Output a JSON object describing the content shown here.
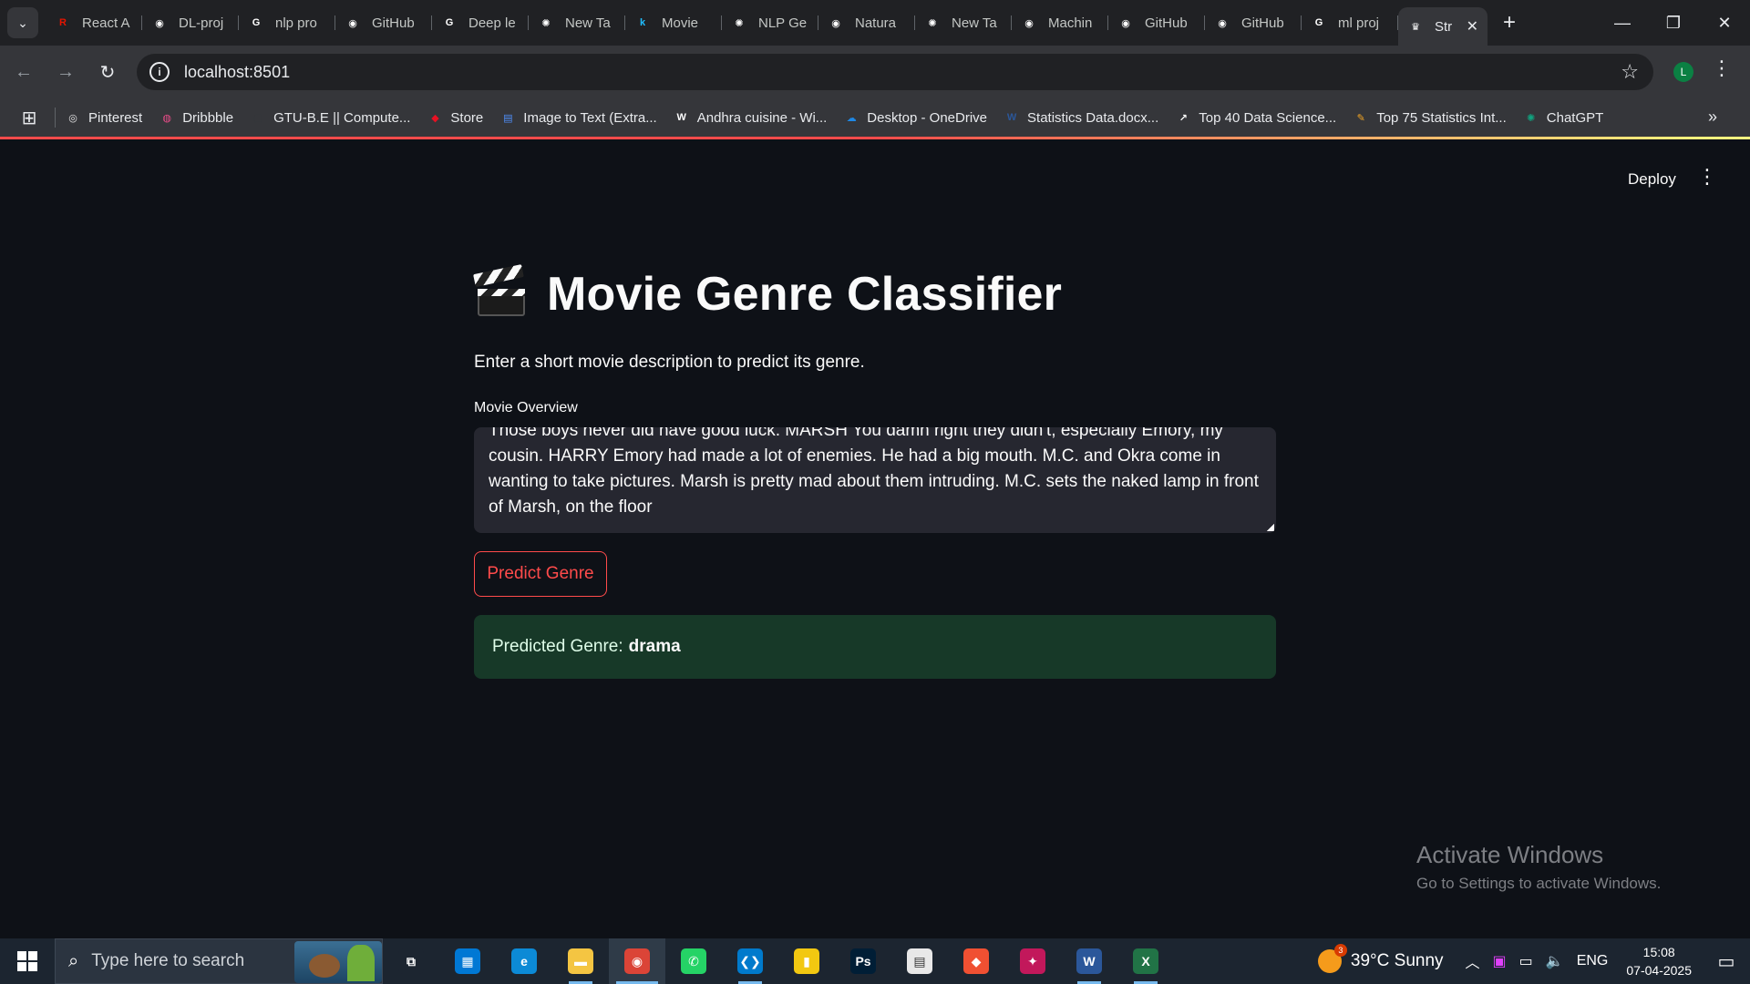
{
  "browser": {
    "tabs": [
      {
        "title": "React A",
        "icon": "react-app-icon",
        "color": "#e51400",
        "glyph": "R"
      },
      {
        "title": "DL-proj",
        "icon": "github-icon",
        "color": "#ffffff",
        "glyph": "◉"
      },
      {
        "title": "nlp pro",
        "icon": "google-icon",
        "color": "#ffffff",
        "glyph": "G"
      },
      {
        "title": "GitHub",
        "icon": "github-icon",
        "color": "#ffffff",
        "glyph": "◉"
      },
      {
        "title": "Deep le",
        "icon": "google-icon",
        "color": "#ffffff",
        "glyph": "G"
      },
      {
        "title": "New Ta",
        "icon": "chatgpt-icon",
        "color": "#ffffff",
        "glyph": "✺"
      },
      {
        "title": "Movie",
        "icon": "kaggle-icon",
        "color": "#20beff",
        "glyph": "k"
      },
      {
        "title": "NLP Ge",
        "icon": "chatgpt-icon",
        "color": "#ffffff",
        "glyph": "✺"
      },
      {
        "title": "Natura",
        "icon": "github-icon",
        "color": "#ffffff",
        "glyph": "◉"
      },
      {
        "title": "New Ta",
        "icon": "chatgpt-icon",
        "color": "#ffffff",
        "glyph": "✺"
      },
      {
        "title": "Machin",
        "icon": "github-icon",
        "color": "#ffffff",
        "glyph": "◉"
      },
      {
        "title": "GitHub",
        "icon": "github-icon",
        "color": "#ffffff",
        "glyph": "◉"
      },
      {
        "title": "GitHub",
        "icon": "github-icon",
        "color": "#ffffff",
        "glyph": "◉"
      },
      {
        "title": "ml proj",
        "icon": "google-icon",
        "color": "#ffffff",
        "glyph": "G"
      }
    ],
    "active_tab": {
      "title": "Str",
      "icon": "streamlit-icon"
    },
    "url": "localhost:8501",
    "bookmarks": [
      {
        "label": "Pinterest",
        "icon": "pinterest-icon",
        "color": "#e6e6e6",
        "glyph": "◎"
      },
      {
        "label": "Dribbble",
        "icon": "dribbble-icon",
        "color": "#ea4c89",
        "glyph": "◍"
      },
      {
        "label": "GTU-B.E || Compute...",
        "icon": "page-icon",
        "color": "#35363a",
        "glyph": "▢"
      },
      {
        "label": "Store",
        "icon": "store-icon",
        "color": "#e81123",
        "glyph": "◆"
      },
      {
        "label": "Image to Text (Extra...",
        "icon": "image-to-text-icon",
        "color": "#4f8ef7",
        "glyph": "▤"
      },
      {
        "label": "Andhra cuisine - Wi...",
        "icon": "wikipedia-icon",
        "color": "#ffffff",
        "glyph": "W"
      },
      {
        "label": "Desktop - OneDrive",
        "icon": "onedrive-icon",
        "color": "#1e88e5",
        "glyph": "☁"
      },
      {
        "label": "Statistics Data.docx...",
        "icon": "word-icon",
        "color": "#2b579a",
        "glyph": "W"
      },
      {
        "label": "Top 40 Data Science...",
        "icon": "chart-icon",
        "color": "#ffffff",
        "glyph": "↗"
      },
      {
        "label": "Top 75 Statistics Int...",
        "icon": "article-icon",
        "color": "#f5a623",
        "glyph": "✎"
      },
      {
        "label": "ChatGPT",
        "icon": "chatgpt-icon",
        "color": "#10a37f",
        "glyph": "✺"
      }
    ],
    "profile_initial": "L"
  },
  "app": {
    "deploy_label": "Deploy",
    "title": "Movie Genre Classifier",
    "subtitle": "Enter a short movie description to predict its genre.",
    "field_label": "Movie Overview",
    "overview_text": "Those boys never did have good luck. MARSH You damn right they didn't, especially Emory, my cousin. HARRY Emory had made a lot of enemies. He had a big mouth. M.C. and Okra come in wanting to take pictures. Marsh is pretty mad about them intruding. M.C. sets the naked lamp in front of Marsh, on the floor",
    "button_label": "Predict Genre",
    "result_prefix": "Predicted Genre:",
    "result_value": "drama",
    "accent_color": "#ff4b4b",
    "success_bg": "#173928"
  },
  "watermark": {
    "line1": "Activate Windows",
    "line2": "Go to Settings to activate Windows."
  },
  "taskbar": {
    "search_placeholder": "Type here to search",
    "apps": [
      {
        "name": "task-view",
        "glyph": "⧉",
        "color": "#1c2530"
      },
      {
        "name": "microsoft-store",
        "glyph": "▦",
        "color": "#0078d4"
      },
      {
        "name": "edge",
        "glyph": "e",
        "color": "#0c8ad6"
      },
      {
        "name": "file-explorer",
        "glyph": "▬",
        "color": "#f4c542"
      },
      {
        "name": "chrome",
        "glyph": "◉",
        "color": "#db4437"
      },
      {
        "name": "whatsapp",
        "glyph": "✆",
        "color": "#25d366"
      },
      {
        "name": "vscode",
        "glyph": "❮❯",
        "color": "#007acc"
      },
      {
        "name": "power-bi",
        "glyph": "▮",
        "color": "#f2c811"
      },
      {
        "name": "photoshop",
        "glyph": "Ps",
        "color": "#001e36"
      },
      {
        "name": "notepad",
        "glyph": "▤",
        "color": "#e8e8e8"
      },
      {
        "name": "git",
        "glyph": "◆",
        "color": "#f05032"
      },
      {
        "name": "paint",
        "glyph": "✦",
        "color": "#c2185b"
      },
      {
        "name": "word",
        "glyph": "W",
        "color": "#2b579a"
      },
      {
        "name": "excel",
        "glyph": "X",
        "color": "#217346"
      }
    ],
    "weather_temp": "39°C",
    "weather_desc": "Sunny",
    "weather_badge": "3",
    "language": "ENG",
    "time": "15:08",
    "date": "07-04-2025"
  }
}
